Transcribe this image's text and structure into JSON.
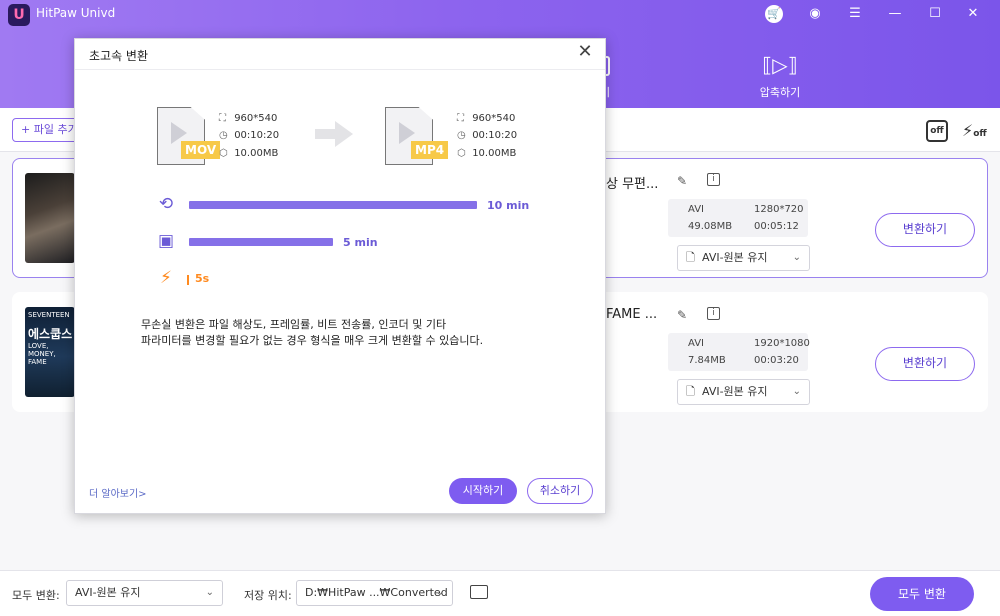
{
  "app": {
    "title": "HitPaw Univd",
    "logo_glyph": "U",
    "header_tabs": [
      {
        "label": "압축하기",
        "icon": "compress-icon"
      },
      {
        "label": "기",
        "icon": "partial-tab-icon"
      }
    ],
    "window_controls": [
      "cart-icon",
      "user-icon",
      "menu-icon",
      "minimize-icon",
      "maximize-icon",
      "close-icon"
    ]
  },
  "toolbar": {
    "add_file_label": "+ 파일 추가",
    "hw_accel_label": "off",
    "fast_label": "off"
  },
  "files": [
    {
      "name": "상 무편...",
      "format": "AVI",
      "resolution": "1280*720",
      "size": "49.08MB",
      "duration": "00:05:12",
      "output_format": "AVI-원본 유지",
      "convert_label": "변환하기"
    },
    {
      "name": "FAME ...",
      "format": "AVI",
      "resolution": "1920*1080",
      "size": "7.84MB",
      "duration": "00:03:20",
      "output_format": "AVI-원본 유지",
      "convert_label": "변환하기",
      "thumb_lines": [
        "SEVENTEEN",
        "에스쿱스",
        "LOVE, MONEY, FAME"
      ]
    }
  ],
  "bottom_bar": {
    "convert_all_label": "모두 변환:",
    "convert_all_value": "AVI-원본 유지",
    "save_location_label": "저장 위치:",
    "save_location_value": "D:₩HitPaw ...₩Converted",
    "convert_all_button": "모두 변환"
  },
  "dialog": {
    "title": "초고속 변환",
    "source": {
      "format": "MOV",
      "resolution": "960*540",
      "duration": "00:10:20",
      "size": "10.00MB"
    },
    "target": {
      "format": "MP4",
      "resolution": "960*540",
      "duration": "00:10:20",
      "size": "10.00MB"
    },
    "rows": [
      {
        "icon": "convert-cycle-icon",
        "label": "10 min",
        "fraction": 1.0
      },
      {
        "icon": "chip-icon",
        "label": "5 min",
        "fraction": 0.5
      },
      {
        "icon": "lightning-icon",
        "label": "5s",
        "fraction": 0.0
      }
    ],
    "description": [
      "무손실 변환은 파일 해상도, 프레임률, 비트 전송률, 인코더 및 기타",
      "파라미터를 변경할 필요가 없는 경우 형식을 매우 크게 변환할 수 있습니다."
    ],
    "learn_more": "더 알아보기>",
    "start_label": "시작하기",
    "cancel_label": "취소하기"
  },
  "colors": {
    "accent": "#7e5cf0",
    "header_start": "#a07af2",
    "header_end": "#7b55ea",
    "format_tag": "#f7c948",
    "fast": "#ff8a1f"
  }
}
